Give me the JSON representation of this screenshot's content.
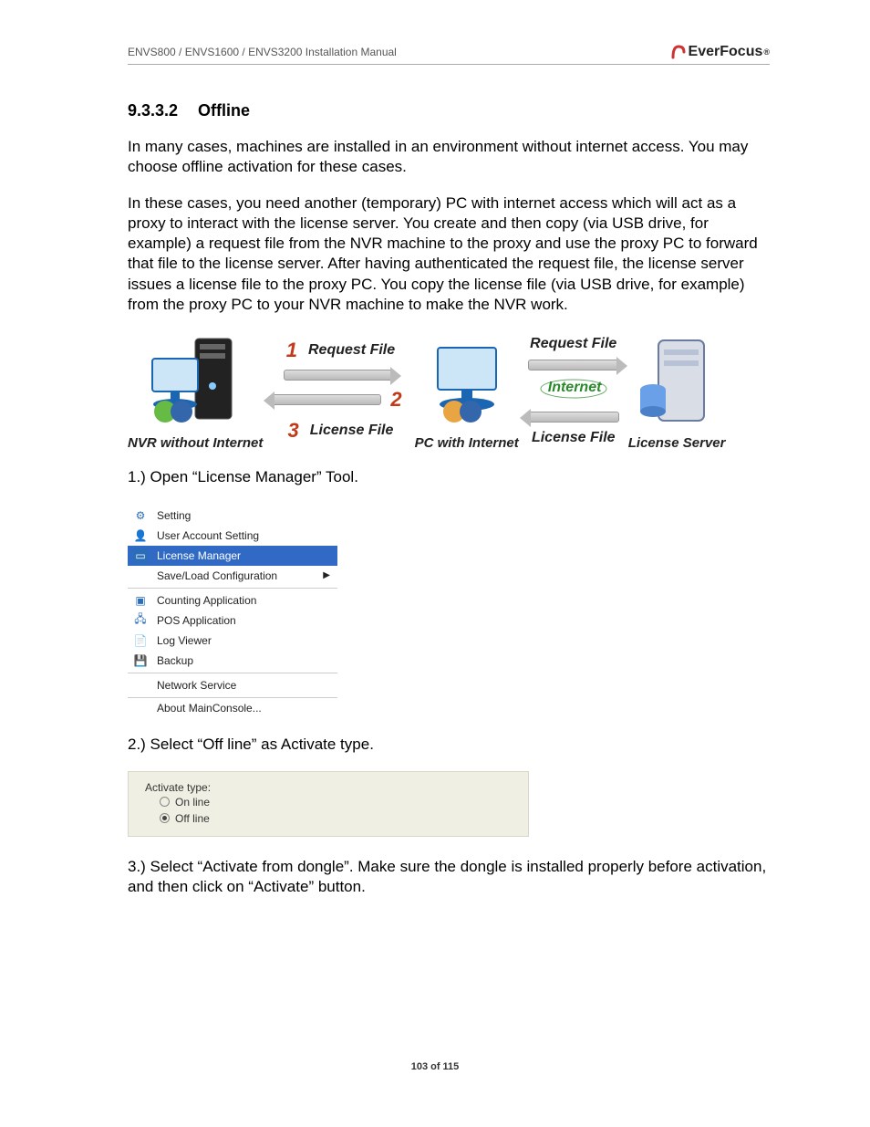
{
  "header": {
    "manual_title": "ENVS800 / ENVS1600 / ENVS3200 Installation Manual",
    "brand": "EverFocus"
  },
  "section": {
    "number": "9.3.3.2",
    "title": "Offline"
  },
  "paragraphs": {
    "p1": "In many cases, machines are installed in an environment without internet access. You may choose offline activation for these cases.",
    "p2": "In these cases, you need another (temporary) PC with internet access which will act as a proxy to interact with the license server. You create and then copy (via USB drive, for example) a request file from the NVR machine to the proxy and use the proxy PC to forward that file to the license server. After having authenticated the request file, the license server issues a license file to the proxy PC. You copy the license file (via USB drive, for example) from the proxy PC to your NVR machine to make the NVR work.",
    "step1": "1.) Open “License Manager” Tool.",
    "step2": "2.) Select “Off line” as Activate type.",
    "step3": "3.) Select “Activate from dongle”.  Make sure the dongle is installed properly before activation, and then click on “Activate” button."
  },
  "diagram": {
    "node_nvr": "NVR without Internet",
    "node_pc": "PC with Internet",
    "node_server": "License Server",
    "label_request": "Request File",
    "label_license": "License File",
    "label_internet": "Internet",
    "n1": "1",
    "n2": "2",
    "n3": "3"
  },
  "menu": {
    "setting": "Setting",
    "user_account": "User Account Setting",
    "license_manager": "License Manager",
    "save_load": "Save/Load Configuration",
    "counting": "Counting Application",
    "pos": "POS Application",
    "log_viewer": "Log Viewer",
    "backup": "Backup",
    "network": "Network Service",
    "about": "About MainConsole..."
  },
  "activate": {
    "label": "Activate type:",
    "online": "On line",
    "offline": "Off line"
  },
  "footer": {
    "page": "103 of 115"
  }
}
